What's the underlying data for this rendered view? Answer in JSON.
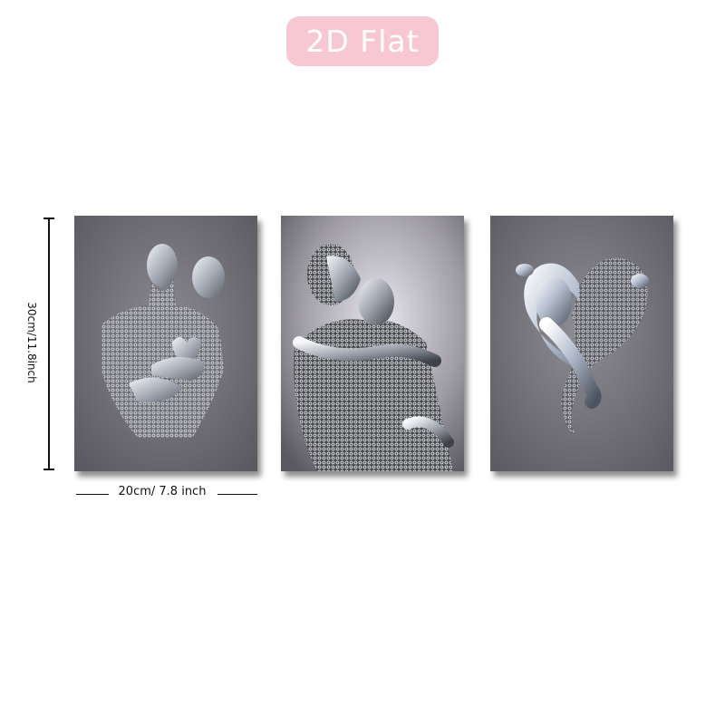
{
  "badge": {
    "label": "2D Flat",
    "color": "#f7c8d2"
  },
  "dimensions": {
    "height_label": "30cm/11.8inch",
    "width_label": "20cm/ 7.8 inch"
  },
  "panels": [
    {
      "subject": "silver-mesh-couple-embrace-sculpture"
    },
    {
      "subject": "silver-mesh-couple-kiss-sculpture"
    },
    {
      "subject": "silver-couple-heart-shape-sculpture"
    }
  ]
}
